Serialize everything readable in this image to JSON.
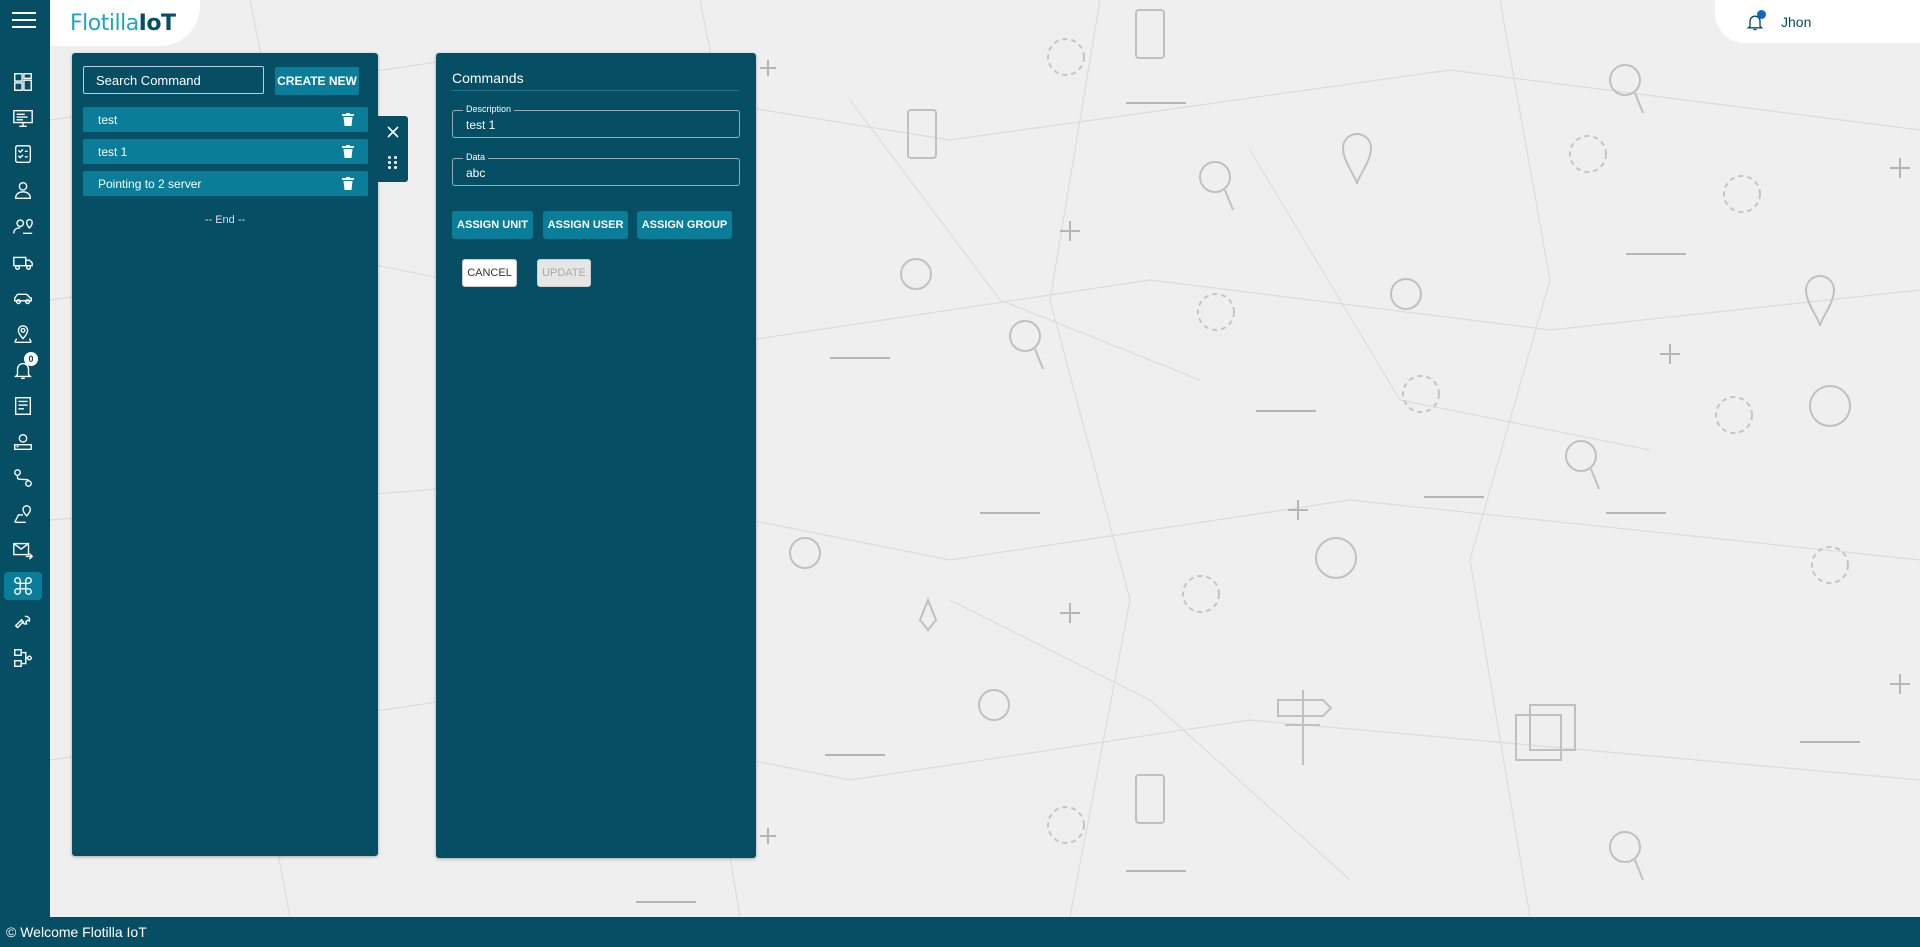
{
  "brand": {
    "logo_part1": "Flotilla",
    "logo_part2": "IoT"
  },
  "header": {
    "user_name": "Jhon"
  },
  "sidebar": {
    "items": [
      {
        "icon": "dashboard-icon"
      },
      {
        "icon": "monitor-icon"
      },
      {
        "icon": "checklist-icon"
      },
      {
        "icon": "user-icon"
      },
      {
        "icon": "user-location-icon"
      },
      {
        "icon": "truck-icon"
      },
      {
        "icon": "car-icon"
      },
      {
        "icon": "map-pin-icon"
      },
      {
        "icon": "bell-icon",
        "badge": "0"
      },
      {
        "icon": "report-icon"
      },
      {
        "icon": "device-user-icon"
      },
      {
        "icon": "route-icon"
      },
      {
        "icon": "route-pin-icon"
      },
      {
        "icon": "mail-send-icon"
      },
      {
        "icon": "command-icon",
        "active": true
      },
      {
        "icon": "wrench-icon"
      },
      {
        "icon": "workflow-icon"
      }
    ]
  },
  "list_panel": {
    "search_placeholder": "Search Command",
    "create_label": "CREATE NEW",
    "items": [
      {
        "label": "test"
      },
      {
        "label": "test 1"
      },
      {
        "label": "Pointing to 2 server"
      }
    ],
    "end_text": "-- End --"
  },
  "form": {
    "title": "Commands",
    "description_label": "Description",
    "description_value": "test 1",
    "data_label": "Data",
    "data_value": "abc",
    "assign_unit": "ASSIGN UNIT",
    "assign_user": "ASSIGN USER",
    "assign_group": "ASSIGN GROUP",
    "cancel": "CANCEL",
    "update": "UPDATE"
  },
  "footer": {
    "text": "© Welcome Flotilla IoT"
  },
  "colors": {
    "primary": "#054e63",
    "accent": "#0a7e98",
    "background": "#efefef"
  }
}
